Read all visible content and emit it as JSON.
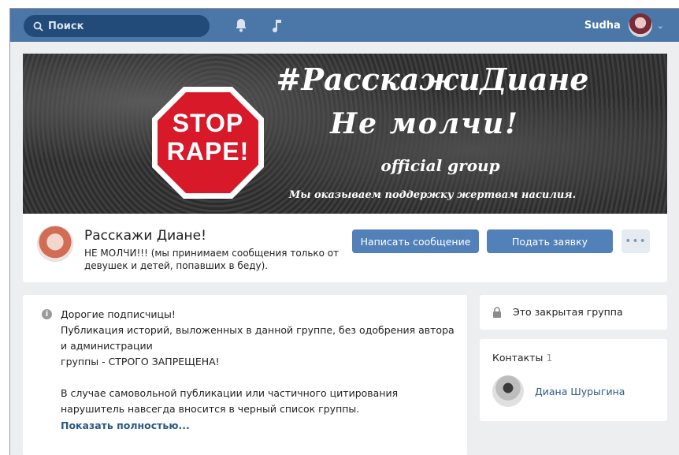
{
  "topbar": {
    "search_placeholder": "Поиск",
    "icons": [
      "search-icon",
      "bell-icon",
      "music-icon"
    ],
    "user_name": "Sudha",
    "chevron": "⌄"
  },
  "cover": {
    "stop_sign_line1": "STOP",
    "stop_sign_line2": "RAPE!",
    "title": "#РасскажиДиане",
    "subtitle": "Не   молчи!",
    "official": "official group",
    "tagline": "Мы оказываем поддержку жертвам насилия."
  },
  "group": {
    "name": "Расскажи Диане!",
    "status": "НЕ МОЛЧИ!!! (мы принимаем сообщения только от девушек и детей, попавших в беду).",
    "message_button": "Написать сообщение",
    "join_button": "Подать заявку",
    "more_button": "•••"
  },
  "post": {
    "lines": [
      "Дорогие подписчицы!",
      "Публикация историй, выложенных в данной группе, без одобрения автора",
      "и администрации",
      "группы - СТРОГО ЗАПРЕЩЕНА!",
      "",
      "В случае самовольной публикации или частичного цитирования",
      "нарушитель навсегда вносится в черный список группы."
    ],
    "show_more": "Показать полностью..."
  },
  "sidebar": {
    "closed_group": "Это закрытая группа",
    "contacts_label": "Контакты",
    "contacts_count": "1",
    "contact_name": "Диана Шурыгина"
  },
  "colors": {
    "header_blue": "#4a76a8",
    "button_blue": "#5181b8",
    "link_blue": "#2a5885",
    "stop_red": "#d7192a"
  }
}
